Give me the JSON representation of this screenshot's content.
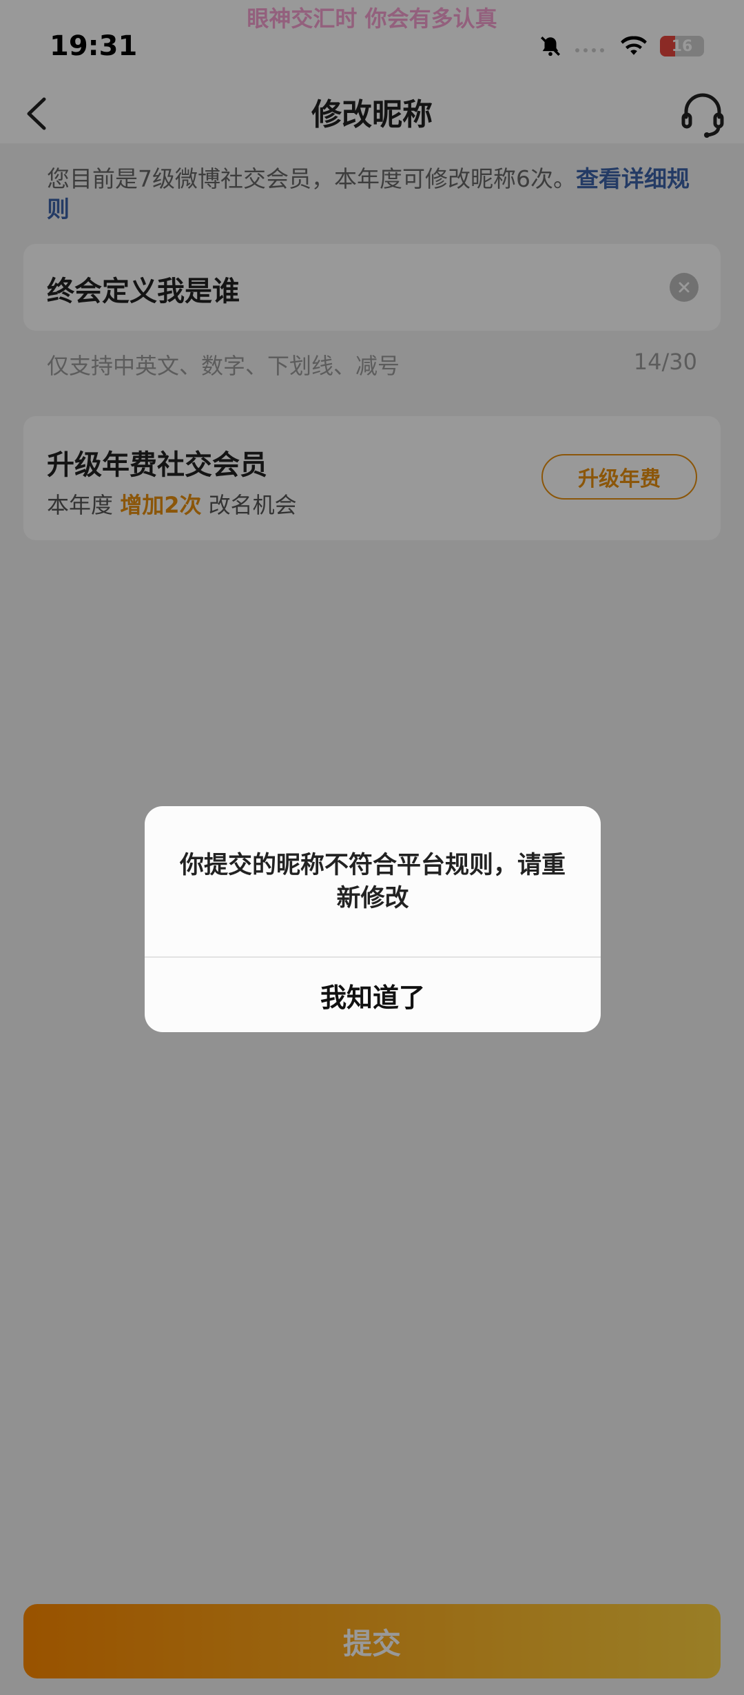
{
  "status_bar": {
    "time": "19:31",
    "marquee": "眼神交汇时 你会有多认真",
    "battery_level": "16"
  },
  "nav": {
    "title": "修改昵称"
  },
  "notice": {
    "text": "您目前是7级微博社交会员，本年度可修改昵称6次。",
    "link": "查看详细规则"
  },
  "nickname": {
    "value": "终会定义我是谁",
    "hint": "仅支持中英文、数字、下划线、减号",
    "counter": "14/30"
  },
  "upgrade": {
    "title": "升级年费社交会员",
    "sub_prefix": "本年度",
    "sub_highlight": "增加2次",
    "sub_suffix": "改名机会",
    "button": "升级年费"
  },
  "submit": {
    "label": "提交"
  },
  "dialog": {
    "message": "你提交的昵称不符合平台规则，请重新修改",
    "confirm": "我知道了"
  },
  "colors": {
    "accent": "#e8900f",
    "link": "#3d63a8"
  }
}
